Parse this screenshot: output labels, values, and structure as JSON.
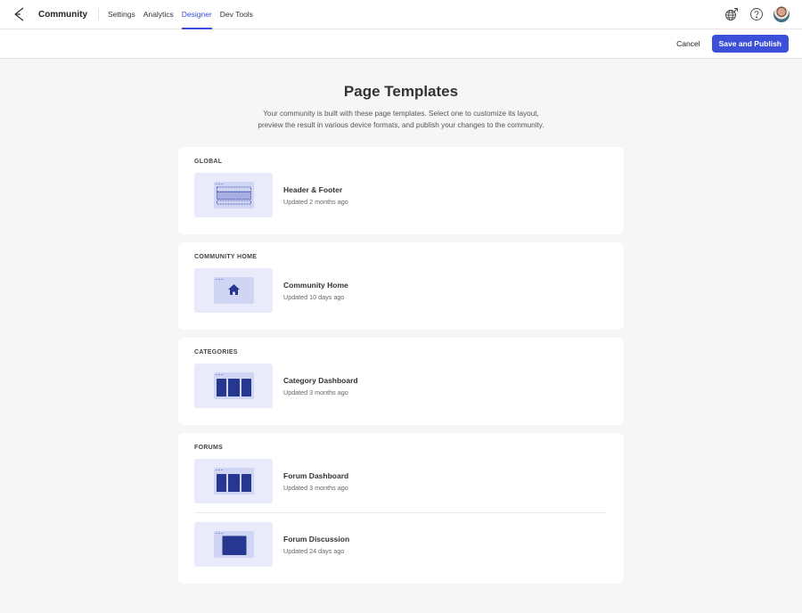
{
  "topnav": {
    "brand": "Community",
    "links": [
      {
        "label": "Settings",
        "active": false
      },
      {
        "label": "Analytics",
        "active": false
      },
      {
        "label": "Designer",
        "active": true
      },
      {
        "label": "Dev Tools",
        "active": false
      }
    ],
    "icons": [
      "globe-link-icon",
      "help-icon",
      "avatar"
    ]
  },
  "actionbar": {
    "cancel_label": "Cancel",
    "publish_label": "Save and Publish"
  },
  "colors": {
    "accent": "#3b4fd8",
    "thumb_bg": "#e9ebfa",
    "thumb_screen": "#d0d5f3",
    "thumb_block": "#25378f"
  },
  "main": {
    "title": "Page Templates",
    "description": "Your community is built with these page templates. Select one to customize its layout, preview the result in various device formats, and publish your changes to the community."
  },
  "sections": [
    {
      "label": "GLOBAL",
      "items": [
        {
          "title": "Header & Footer",
          "updated": "Updated 2 months ago",
          "thumb": "header-footer"
        }
      ]
    },
    {
      "label": "COMMUNITY HOME",
      "items": [
        {
          "title": "Community Home",
          "updated": "Updated 10 days ago",
          "thumb": "home"
        }
      ]
    },
    {
      "label": "CATEGORIES",
      "items": [
        {
          "title": "Category Dashboard",
          "updated": "Updated 3 months ago",
          "thumb": "three-columns"
        }
      ]
    },
    {
      "label": "FORUMS",
      "items": [
        {
          "title": "Forum Dashboard",
          "updated": "Updated 3 months ago",
          "thumb": "three-columns"
        },
        {
          "title": "Forum Discussion",
          "updated": "Updated 24 days ago",
          "thumb": "single-block"
        }
      ]
    }
  ]
}
